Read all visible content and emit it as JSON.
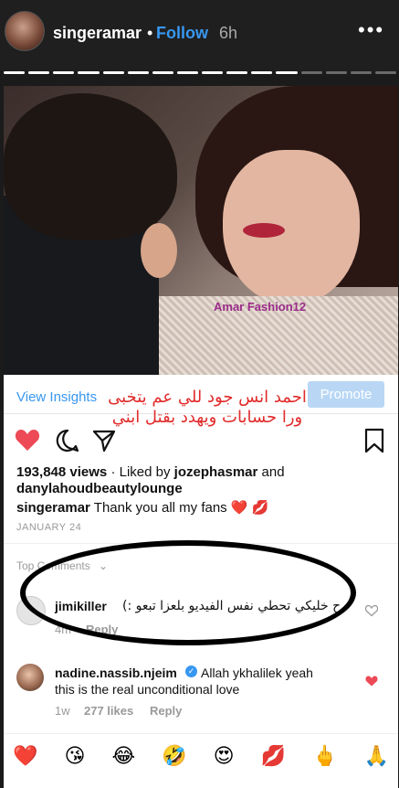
{
  "story": {
    "username": "singeramar",
    "dot": "•",
    "follow": "Follow",
    "time": "6h",
    "more": "•••",
    "progress": [
      1,
      1,
      1,
      1,
      1,
      1,
      1,
      1,
      1,
      1,
      1,
      1,
      0,
      0,
      0,
      0
    ],
    "progress_done_color": "#ffffff",
    "progress_todo_color": "#6b6b6b"
  },
  "post": {
    "watermark": "Amar Fashion12",
    "view_insights": "View Insights",
    "promote": "Promote",
    "overlay_text_line1": "احمد انس جود للي عم يتخبى",
    "overlay_text_line2": "ورا حسابات ويهدد بقتل ابني",
    "views_count": "193,848 views",
    "liked_by_prefix": "· Liked by",
    "liked_by_user1": "jozephasmar",
    "liked_by_and": "and",
    "liked_by_user2": "danylahoudbeautylounge",
    "caption_user": "singeramar",
    "caption_text": "Thank you all my fans ❤️ 💋",
    "date": "JANUARY 24",
    "top_comments_label": "Top Comments",
    "accent": "#3897f0",
    "heart_color": "#ed4956"
  },
  "comments": [
    {
      "user": "jimikiller",
      "text": "رح خليكي تحطي نفس الفيديو بلعزا تبعو :)",
      "age": "4m",
      "reply": "Reply"
    },
    {
      "user": "nadine.nassib.njeim",
      "verified": true,
      "text_line1": "Allah ykhalilek yeah",
      "text_line2": "this is the real unconditional love",
      "age": "1w",
      "likes": "277 likes",
      "reply": "Reply"
    }
  ],
  "emoji_bar": [
    "❤️",
    "😘",
    "😂",
    "🤣",
    "😍",
    "💋",
    "🖕",
    "🙏"
  ]
}
